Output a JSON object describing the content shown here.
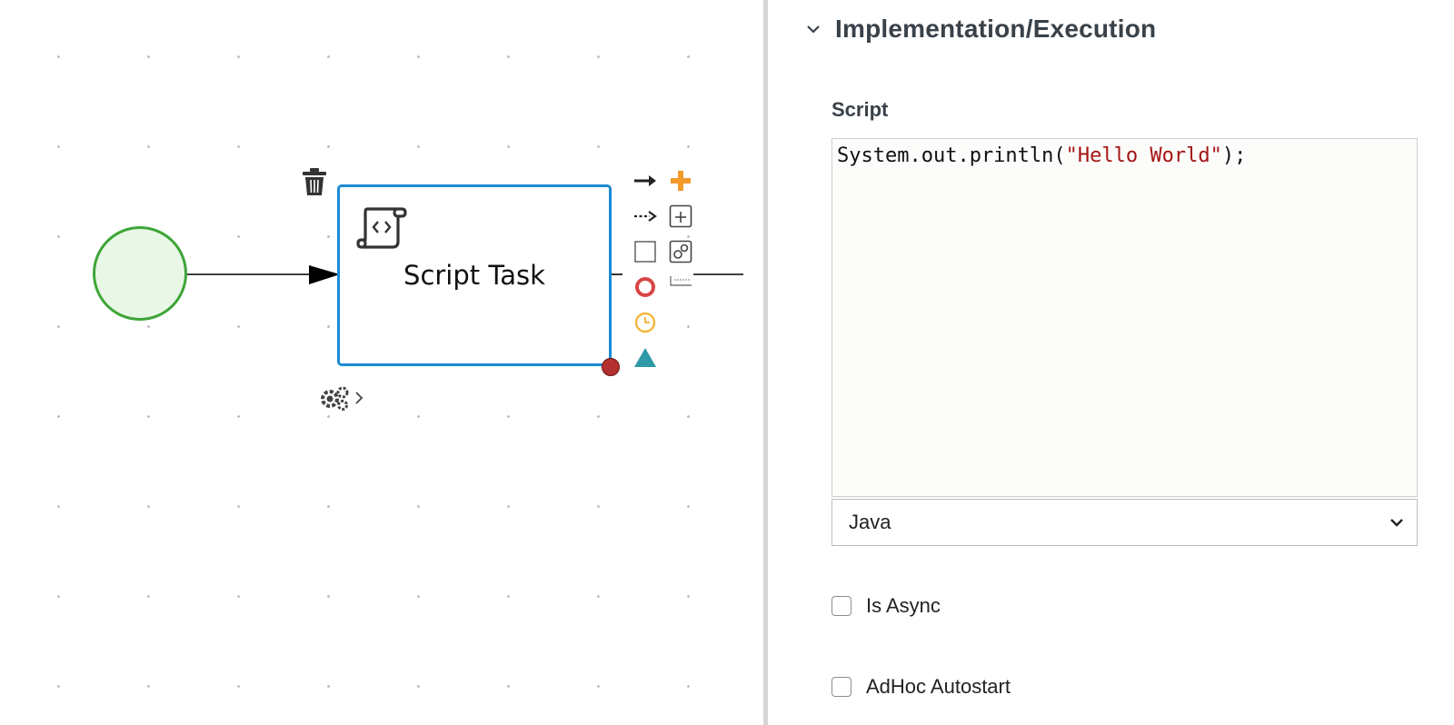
{
  "diagram": {
    "task_name": "Script Task",
    "task_type_icon": "script-scroll-icon",
    "tools": {
      "delete": "trash-icon",
      "settings": "gears-icon",
      "toolbox": [
        {
          "name": "sequence-flow-icon",
          "color": "#222222"
        },
        {
          "name": "plus-icon",
          "color": "#f39a2a"
        },
        {
          "name": "association-flow-icon",
          "color": "#222222"
        },
        {
          "name": "subprocess-icon",
          "color": "#444444"
        },
        {
          "name": "task-icon",
          "color": "#555555"
        },
        {
          "name": "reusable-subprocess-icon",
          "color": "#444444"
        },
        {
          "name": "end-event-icon",
          "color": "#d94545"
        },
        {
          "name": "text-annotation-icon",
          "color": "#777777"
        },
        {
          "name": "timer-event-icon",
          "color": "#f3b73c"
        },
        {
          "name": "gateway-icon",
          "color": "#2e9aa6"
        }
      ]
    },
    "colors": {
      "start_event_stroke": "#3ea638",
      "start_event_fill": "#e9f7e6",
      "task_stroke": "#1c8bd3",
      "boundary_handle": "#b42f2f"
    }
  },
  "properties": {
    "section_title": "Implementation/Execution",
    "section_icon": "chevron-down-icon",
    "script_label": "Script",
    "script_code": "System.out.println(\"Hello World\");",
    "script_code_prefix": "System.out.println(",
    "script_code_string": "\"Hello World\"",
    "script_code_suffix": ");",
    "language_value": "Java",
    "is_async_label": "Is Async",
    "is_async_checked": false,
    "adhoc_autostart_label": "AdHoc Autostart",
    "adhoc_autostart_checked": false
  }
}
